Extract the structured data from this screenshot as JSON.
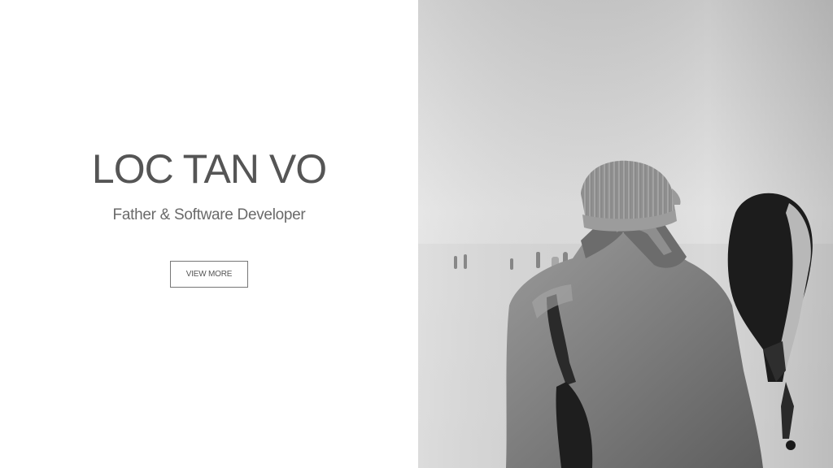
{
  "hero": {
    "name": "LOC TAN VO",
    "tagline": "Father & Software Developer",
    "cta_label": "VIEW MORE"
  },
  "photo": {
    "icon": "photo-of-father-carrying-child",
    "colors": {
      "sky": "#e4e4e4",
      "ground": "#d6d6d6",
      "coat": "#7a7a7a",
      "dark": "#1c1c1c"
    }
  }
}
